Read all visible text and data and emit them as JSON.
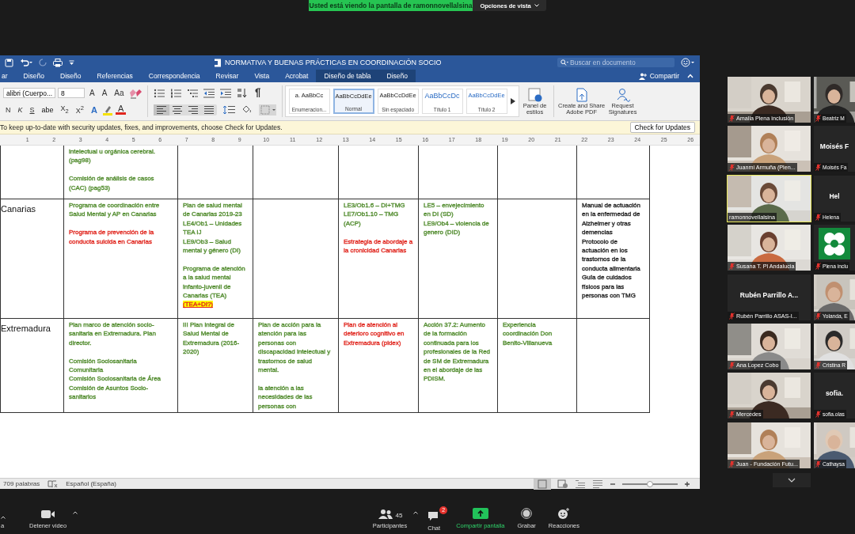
{
  "share_banner": {
    "text": "Usted está viendo la pantalla de ramonnovellalsina",
    "view_options": "Opciones de vista"
  },
  "word": {
    "title": "NORMATIVA Y BUENAS PRÁCTICAS EN COORDINACIÓN SOCIO",
    "search": {
      "placeholder": "Buscar en documento"
    },
    "tabs": [
      {
        "label": "ar",
        "contextual": false
      },
      {
        "label": "Diseño",
        "contextual": false
      },
      {
        "label": "Diseño",
        "contextual": false
      },
      {
        "label": "Referencias",
        "contextual": false
      },
      {
        "label": "Correspondencia",
        "contextual": false
      },
      {
        "label": "Revisar",
        "contextual": false
      },
      {
        "label": "Vista",
        "contextual": false
      },
      {
        "label": "Acrobat",
        "contextual": false
      },
      {
        "label": "Diseño de tabla",
        "contextual": true
      },
      {
        "label": "Diseño",
        "contextual": true
      }
    ],
    "share": "Compartir",
    "ribbon": {
      "font": "alibri (Cuerpo...",
      "size": "8",
      "font_tools": [
        "A",
        "A",
        "Aa"
      ],
      "format_buttons": [
        "N",
        "K",
        "S",
        "abe",
        "X$_{2}$",
        "X$^{2}$"
      ],
      "color_buttons": [
        "A",
        "A"
      ],
      "alignments": [
        {
          "kind": "left",
          "selected": true
        },
        {
          "kind": "center",
          "selected": false
        },
        {
          "kind": "right",
          "selected": false
        },
        {
          "kind": "justify",
          "selected": false
        }
      ],
      "styles": [
        {
          "kind": "list",
          "preview": "a.  AaBbCc",
          "name": "Enumeracion...",
          "selected": false
        },
        {
          "kind": "normal",
          "preview": "AaBbCcDdEe",
          "name": "Normal",
          "selected": true
        },
        {
          "kind": "normal",
          "preview": "AaBbCcDdEe",
          "name": "Sin espaciado",
          "selected": false
        },
        {
          "kind": "heading",
          "preview": "AaBbCcDc",
          "name": "Título 1",
          "selected": false
        },
        {
          "kind": "heading2",
          "preview": "AaBbCcDdEe",
          "name": "Título 2",
          "selected": false
        }
      ],
      "styles_pane": "Panel de estilos",
      "adobe_pdf": "Create and Share Adobe PDF",
      "signatures": "Request Signatures"
    },
    "update_bar": {
      "message": "To keep up-to-date with security updates, fixes, and improvements, choose Check for Updates.",
      "button": "Check for Updates"
    },
    "ruler": [
      "1",
      "2",
      "3",
      "4",
      "5",
      "6",
      "7",
      "8",
      "9",
      "10",
      "11",
      "12",
      "13",
      "14",
      "15",
      "16",
      "17",
      "18",
      "19",
      "20",
      "21",
      "22",
      "23",
      "24",
      "25",
      "26"
    ],
    "table": {
      "rows": [
        {
          "cells": [
            [
              [
                {
                  "text": "intelectual u orgánica cerebral. (pag98)",
                  "color": "#4f8a2b"
                }
              ],
              [
                {
                  "text": "Comisión de análisis de casos (CAC) (pag53)",
                  "color": "#4f8a2b"
                }
              ]
            ],
            [],
            [],
            [],
            [],
            [],
            []
          ]
        },
        {
          "region": "Canarias",
          "cells": [
            [
              [
                {
                  "text": "Programa de coordinación entre Salud Mental y AP en Canarias",
                  "color": "#4f8a2b"
                }
              ],
              [
                {
                  "text": "Programa de prevención de la conducta suicida en Canarias",
                  "color": "#e0261e"
                }
              ]
            ],
            [
              [
                {
                  "text": "Plan de salud mental de Canarias 2019-23",
                  "color": "#4f8a2b"
                },
                {
                  "text": "LE4/Ob1 – Unidades TEA IJ",
                  "color": "#4f8a2b"
                },
                {
                  "text": "LE9/Ob3 – Salud mental y género (DI)",
                  "color": "#4f8a2b"
                }
              ],
              [
                {
                  "text": "Programa de atención a la salud mental infanto-juvenil de Canarias (TEA)",
                  "color": "#4f8a2b",
                  "highlight": "(TEA+DI?)"
                }
              ]
            ],
            [],
            [
              [
                {
                  "text": "LE3/Ob1.6 – DI+TMG",
                  "color": "#4f8a2b"
                },
                {
                  "text": "LE7/Ob1.10 – TMG (ACP)",
                  "color": "#4f8a2b"
                }
              ],
              [
                {
                  "text": "Estrategia de abordaje a la cronicidad Canarias",
                  "color": "#e0261e"
                }
              ]
            ],
            [
              [
                {
                  "text": "LE5 – envejecimiento en DI (SD)",
                  "color": "#4f8a2b"
                },
                {
                  "text": "LE9/Ob4 – violencia de genero (DID)",
                  "color": "#4f8a2b"
                }
              ]
            ],
            [],
            [
              [
                {
                  "text": "Manual de actuación en la enfermedad de Alzheimer y otras demencias",
                  "color": "#222222"
                },
                {
                  "text": "Protocolo de actuación en los trastornos de la conducta alimentaria",
                  "color": "#222222"
                },
                {
                  "text": "Guía de cuidados físicos para las personas con TMG",
                  "color": "#222222"
                }
              ]
            ]
          ]
        },
        {
          "region": "Extremadura",
          "cells": [
            [
              [
                {
                  "text": "Plan marco de atención socio-sanitaria en Extremadura. Plan director.",
                  "color": "#4f8a2b"
                }
              ],
              [
                {
                  "text": "Comisión Sociosanitaria Comunitaria",
                  "color": "#4f8a2b"
                },
                {
                  "text": "Comisión Sociosanitaria de Área",
                  "color": "#4f8a2b"
                },
                {
                  "text": "Comisión de Asuntos Socio-sanitarios",
                  "color": "#4f8a2b"
                }
              ]
            ],
            [
              [
                {
                  "text": "III Plan Integral de Salud Mental de Extremadura (2016-2020)",
                  "color": "#4f8a2b"
                }
              ]
            ],
            [
              [
                {
                  "text": "Plan de acción para la atención para las personas con discapacidad intelectual y trastornos de salud mental.",
                  "color": "#4f8a2b"
                }
              ],
              [
                {
                  "text": "la atención a las necesidades de las personas con",
                  "color": "#4f8a2b"
                }
              ]
            ],
            [
              [
                {
                  "text": "Plan de atención al deterioro cognitivo en Extremadura (pidex)",
                  "color": "#e0261e"
                }
              ]
            ],
            [
              [
                {
                  "text": "Acción 37.2: Aumento de la formación continuada para los profesionales de la Red de SM de Extremadura en el abordaje de las PDISM.",
                  "color": "#4f8a2b"
                }
              ]
            ],
            [
              [
                {
                  "text": "Experiencia coordinación Don Benito-Villanueva",
                  "color": "#4f8a2b"
                }
              ]
            ],
            []
          ]
        }
      ]
    },
    "status": {
      "words": "709 palabras",
      "language": "Español (España)",
      "zoom": {
        "level": 0.5
      }
    }
  },
  "gallery": {
    "tiles": [
      {
        "kind": "video",
        "name": "Amalia Plena inclusión",
        "muted": true,
        "speaking": false
      },
      {
        "kind": "video",
        "name": "Beatriz M",
        "muted": true,
        "speaking": false
      },
      {
        "kind": "video",
        "name": "Juanmi Armuña (Plen...",
        "muted": true,
        "speaking": false
      },
      {
        "kind": "name",
        "display": "Moisés F",
        "name": "Moisés Fa",
        "muted": true,
        "speaking": false
      },
      {
        "kind": "video",
        "name": "ramonnovellalsina",
        "muted": false,
        "speaking": true
      },
      {
        "kind": "name",
        "display": "Hel",
        "name": "Helena",
        "muted": true,
        "speaking": false
      },
      {
        "kind": "video",
        "name": "Susana T. Pl Andalucia",
        "muted": true,
        "speaking": false
      },
      {
        "kind": "logo",
        "name": "Plena inclu",
        "muted": true,
        "speaking": false
      },
      {
        "kind": "name",
        "display": "Rubén Parrillo A...",
        "name": "Rubén Parrillo ASAS-I...",
        "muted": true,
        "speaking": false
      },
      {
        "kind": "video",
        "name": "Yolanda, E",
        "muted": true,
        "speaking": false
      },
      {
        "kind": "video",
        "name": "Ana Lopez Cobo",
        "muted": true,
        "speaking": false
      },
      {
        "kind": "video",
        "name": "Cristina R",
        "muted": true,
        "speaking": false
      },
      {
        "kind": "video",
        "name": "Mercedes",
        "muted": true,
        "speaking": false
      },
      {
        "kind": "name",
        "display": "sofia.",
        "name": "sofia.olas",
        "muted": true,
        "speaking": false
      },
      {
        "kind": "video",
        "name": "Juan - Fundación Futu...",
        "muted": true,
        "speaking": false
      },
      {
        "kind": "video",
        "name": "Cathaysa",
        "muted": true,
        "speaking": false
      }
    ]
  },
  "toolbar": [
    {
      "kind": "audio",
      "label": "a"
    },
    {
      "kind": "video",
      "label": "Detener vídeo"
    },
    {
      "kind": "participants",
      "label": "Participantes",
      "count": "45"
    },
    {
      "kind": "chat",
      "label": "Chat",
      "badge": "2"
    },
    {
      "kind": "share",
      "label": "Compartir pantalla"
    },
    {
      "kind": "record",
      "label": "Grabar"
    },
    {
      "kind": "reactions",
      "label": "Reacciones"
    }
  ]
}
